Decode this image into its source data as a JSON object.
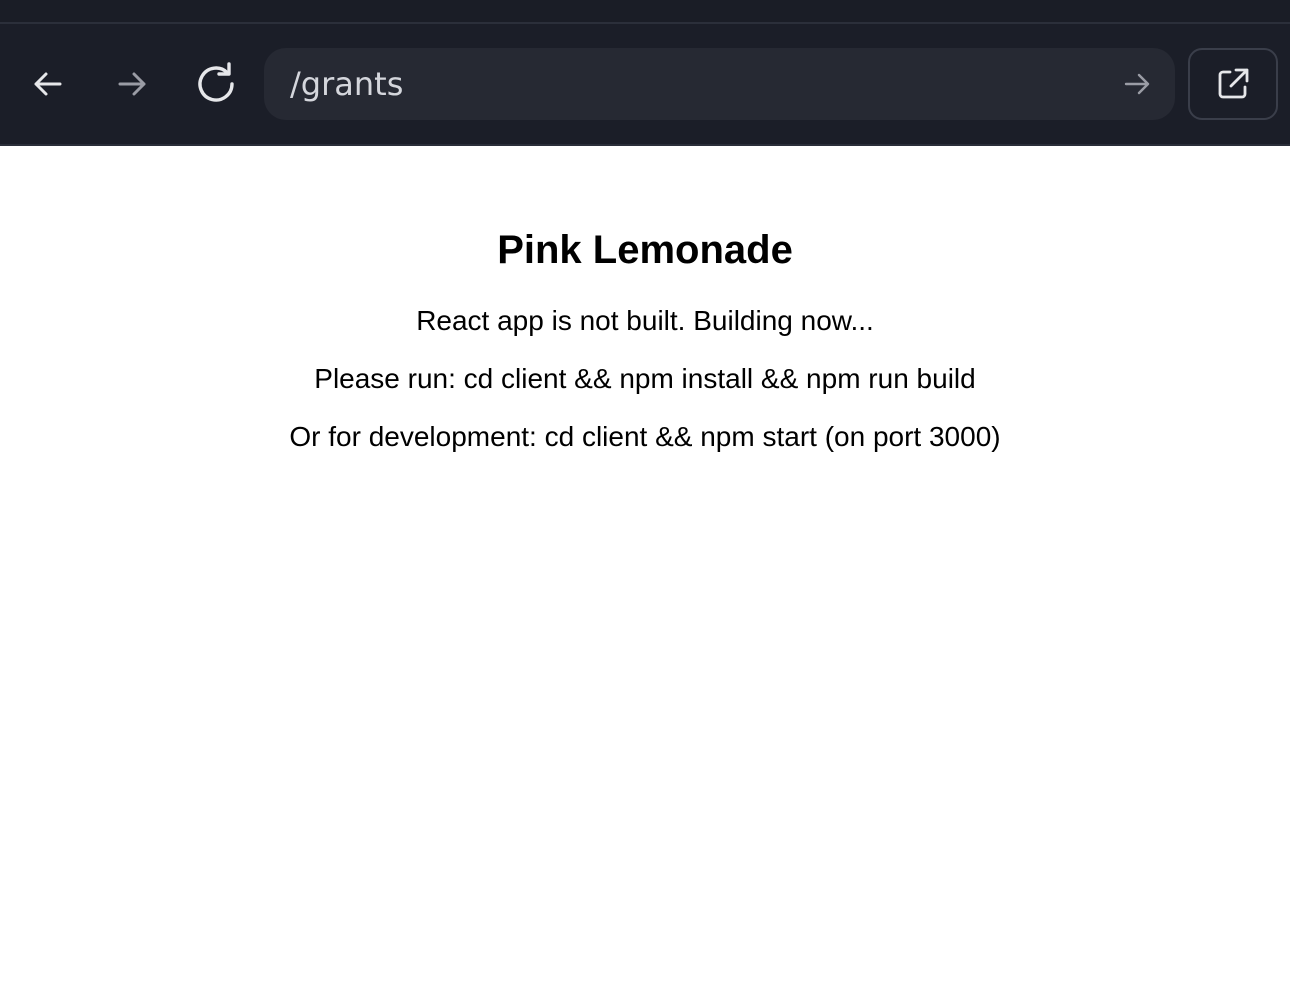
{
  "browser": {
    "address_value": "/grants",
    "icons": {
      "back": "arrow-left-icon",
      "forward": "arrow-right-icon",
      "reload": "reload-icon",
      "go": "arrow-right-icon",
      "open_external": "external-link-icon"
    },
    "colors": {
      "toolbar_bg": "#1b1e28",
      "urlbar_bg": "#262933",
      "icon_active": "#e6e7ea",
      "icon_dim": "#9a9ca5"
    }
  },
  "page": {
    "title": "Pink Lemonade",
    "lines": [
      "React app is not built. Building now...",
      "Please run: cd client && npm install && npm run build",
      "Or for development: cd client && npm start (on port 3000)"
    ]
  }
}
